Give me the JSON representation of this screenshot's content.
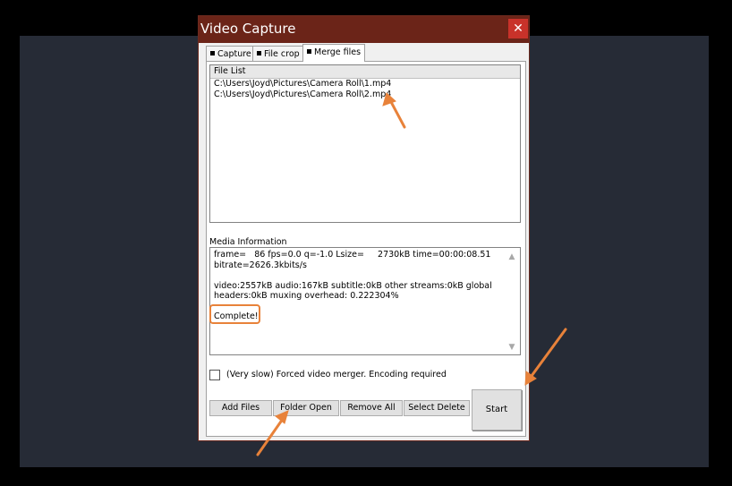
{
  "window": {
    "title": "Video Capture",
    "close_glyph": "✕"
  },
  "tabs": [
    {
      "label": "Capture",
      "active": false
    },
    {
      "label": "File crop",
      "active": false
    },
    {
      "label": "Merge files",
      "active": true
    }
  ],
  "file_list": {
    "header": "File List",
    "items": [
      "C:\\Users\\Joyd\\Pictures\\Camera Roll\\1.mp4",
      "C:\\Users\\Joyd\\Pictures\\Camera Roll\\2.mp4"
    ]
  },
  "media_info": {
    "label": "Media Information",
    "text": "frame=   86 fps=0.0 q=-1.0 Lsize=     2730kB time=00:00:08.51\nbitrate=2626.3kbits/s\n\nvideo:2557kB audio:167kB subtitle:0kB other streams:0kB global\nheaders:0kB muxing overhead: 0.222304%\n\nComplete!"
  },
  "options": {
    "forced_merge_label": "(Very slow) Forced video merger. Encoding required",
    "forced_merge_checked": false
  },
  "buttons": {
    "add_files": "Add Files",
    "folder_open": "Folder Open",
    "remove_all": "Remove All",
    "select_delete": "Select Delete",
    "start": "Start"
  },
  "colors": {
    "annotation": "#e8823a",
    "titlebar": "#6b2418",
    "close": "#c8322a",
    "backdrop": "#262b36"
  },
  "icons": {
    "close": "close-icon",
    "scroll_up": "chevron-up-icon",
    "scroll_down": "chevron-down-icon"
  }
}
